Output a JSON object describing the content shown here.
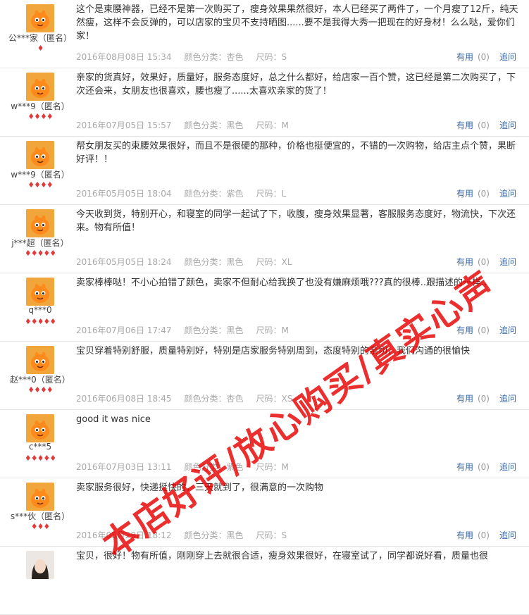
{
  "labels": {
    "color_prefix": "颜色分类：",
    "size_prefix": "尺码：",
    "useful": "有用",
    "ask": "追问"
  },
  "watermark": "本店好评/放心购买/真实心声",
  "reviews": [
    {
      "username": "公***家（匿名）",
      "hearts": "♦",
      "content": "这个是束腰神器，已经不是第一次购买了，瘦身效果果然很好，本人已经买了两件了，一个月瘦了12斤，纯天然瘦，这样不会反弹的，可以店家的宝贝不支持晒图......要不是我得大秀一把现在的好身材！么么哒，爱你们家！",
      "date": "2016年08月08日 15:34",
      "color": "杏色",
      "size": "S",
      "useful_count": "(0)"
    },
    {
      "username": "w***9（匿名）",
      "hearts": "♦♦♦♦",
      "content": "亲家的货真好，效果好，质量好，服务态度好，总之什么都好，给店家一百个赞，这已经是第二次购买了，下次还会来，女朋友也很喜欢，腰也瘦了......太喜欢亲家的货了！",
      "date": "2016年07月05日 15:57",
      "color": "黑色",
      "size": "M",
      "useful_count": "(0)"
    },
    {
      "username": "w***9（匿名）",
      "hearts": "♦♦♦♦",
      "content": "帮女朋友买的束腰效果很好，而且不是很硬的那种，价格也挺便宜的，不错的一次购物，给店主点个赞，果断好评！！",
      "date": "2016年05月05日 18:04",
      "color": "紫色",
      "size": "L",
      "useful_count": "(0)"
    },
    {
      "username": "j***超（匿名）",
      "hearts": "♦♦♦♦♦",
      "content": "今天收到货，特别开心，和寝室的同学一起试了下，收腹，瘦身效果显著，客服服务态度好，物流快，下次还来。物有所值！",
      "date": "2016年05月05日 18:24",
      "color": "黑色",
      "size": "XL",
      "useful_count": "(0)"
    },
    {
      "username": "q***0",
      "hearts": "♦♦♦♦♦",
      "content": "卖家棒棒哒！不小心拍错了颜色，卖家不但耐心给我换了也没有嫌麻烦哦???真的很棒..跟描述的一样..",
      "date": "2016年07月06日 17:47",
      "color": "黑色",
      "size": "M",
      "useful_count": "(0)"
    },
    {
      "username": "赵***0（匿名）",
      "hearts": "♦♦♦♦",
      "content": "宝贝穿着特别舒服，质量特别好，特别是店家服务特别周到，态度特别的亲切，我们沟通的很愉快",
      "date": "2016年06月08日 18:45",
      "color": "杏色",
      "size": "XS",
      "useful_count": "(0)"
    },
    {
      "username": "c***5",
      "hearts": "♦♦♦♦♦",
      "content": "good it was nice",
      "date": "2016年07月03日 13:11",
      "color": "紫色",
      "size": "M",
      "useful_count": "(0)"
    },
    {
      "username": "s***伙（匿名）",
      "hearts": "♦♦♦",
      "content": "卖家服务很好，快递挺快的，三天就到了，很满意的一次购物",
      "date": "2016年05月29日 18:12",
      "color": "黑色",
      "size": "S",
      "useful_count": "(0)"
    },
    {
      "username": "",
      "hearts": "",
      "content": "宝贝，很好！物有所值，刚刚穿上去就很合适，瘦身效果很好，在寝室试了，同学都说好看，质量也很",
      "date": "",
      "color": "",
      "size": "",
      "useful_count": ""
    }
  ]
}
